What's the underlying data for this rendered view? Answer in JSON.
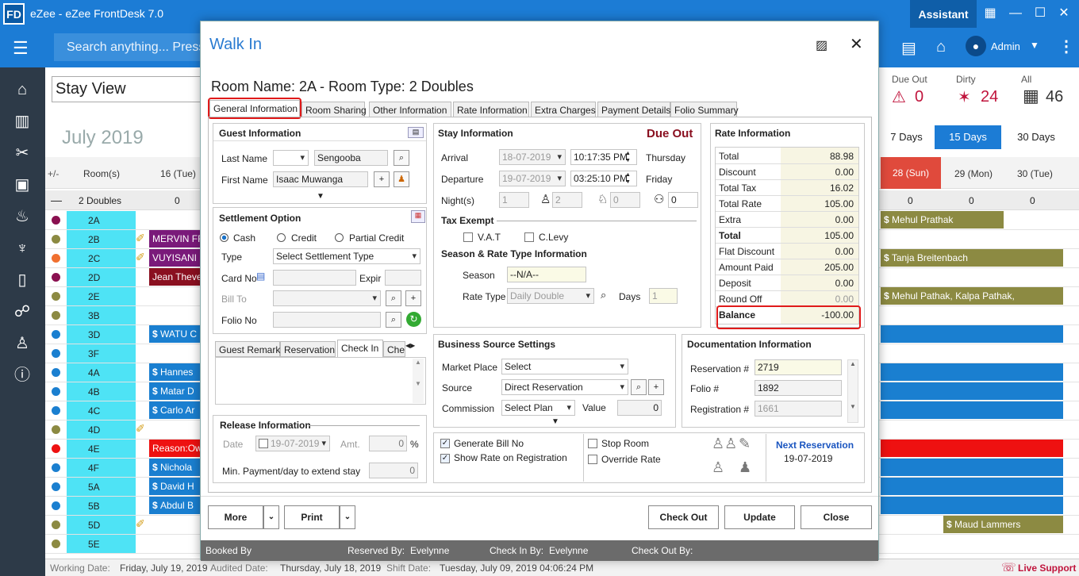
{
  "app": {
    "logo": "FD",
    "title": "eZee - eZee FrontDesk 7.0",
    "assistant": "Assistant",
    "user": "Admin"
  },
  "search": {
    "placeholder": "Search anything... Press"
  },
  "background": {
    "view_selector": "Stay View",
    "month": "July 2019",
    "stats": [
      {
        "label": "Due Out",
        "value": "0"
      },
      {
        "label": "Dirty",
        "value": "24"
      },
      {
        "label": "All",
        "value": "46"
      }
    ],
    "range_tabs": [
      "7 Days",
      "15 Days",
      "30 Days"
    ],
    "columns": {
      "plusminus": "+/-",
      "rooms": "Room(s)",
      "d16": "16 (Tue)",
      "d28": "28 (Sun)",
      "d29": "29 (Mon)",
      "d30": "30 (Tue)"
    },
    "group": {
      "name": "2 Doubles",
      "c16": "0",
      "c28": "0",
      "c29": "0",
      "c30": "0"
    },
    "rooms": [
      "2A",
      "2B",
      "2C",
      "2D",
      "2E",
      "3B",
      "3D",
      "3F",
      "4A",
      "4B",
      "4C",
      "4D",
      "4E",
      "4F",
      "5A",
      "5B",
      "5D",
      "5E"
    ],
    "left_guests": [
      "MERVIN FRA",
      "VUYISANI N",
      "Jean Thever",
      "WATU C",
      "Hannes",
      "Matar D",
      "Carlo Ar",
      "Reason:Own",
      "Nichola",
      "David H",
      "Abdul B"
    ],
    "right_guests": [
      "Mehul Prathak",
      "Tanja Breitenbach",
      "Mehul Pathak, Kalpa Pathak,",
      "Maud Lammers"
    ],
    "status": {
      "working_label": "Working Date:",
      "working": "Friday, July 19, 2019",
      "audited_label": "Audited Date:",
      "audited": "Thursday, July 18, 2019",
      "shift_label": "Shift Date:",
      "shift": "Tuesday, July 09, 2019 04:06:24 PM",
      "support": "Live Support"
    }
  },
  "dialog": {
    "title": "Walk In",
    "room_heading": "Room Name: 2A - Room Type: 2 Doubles",
    "tabs": [
      "General Information",
      "Room Sharing",
      "Other Information",
      "Rate Information",
      "Extra Charges",
      "Payment Details",
      "Folio Summary"
    ],
    "guest": {
      "heading": "Guest Information",
      "last_name_label": "Last Name",
      "last_name": "Sengooba",
      "first_name_label": "First Name",
      "first_name": "Isaac Muwanga"
    },
    "settlement": {
      "heading": "Settlement Option",
      "options": [
        "Cash",
        "Credit",
        "Partial Credit"
      ],
      "type_label": "Type",
      "type_value": "Select Settlement Type",
      "card_label": "Card No",
      "expiry_label": "Expir",
      "bill_to_label": "Bill To",
      "folio_label": "Folio No"
    },
    "remark_tabs": [
      "Guest Remark",
      "Reservation",
      "Check In",
      "Che"
    ],
    "release": {
      "heading": "Release Information",
      "date_label": "Date",
      "date": "19-07-2019",
      "amt_label": "Amt.",
      "amt": "0",
      "pct": "%",
      "min_pay_label": "Min. Payment/day to extend stay",
      "min_pay": "0"
    },
    "stay": {
      "heading": "Stay Information",
      "due_out": "Due Out",
      "arrival_label": "Arrival",
      "arrival_date": "18-07-2019",
      "arrival_time": "10:17:35 PM",
      "arrival_day": "Thursday",
      "departure_label": "Departure",
      "departure_date": "19-07-2019",
      "departure_time": "03:25:10 PM",
      "departure_day": "Friday",
      "nights_label": "Night(s)",
      "nights": "1",
      "adults": "2",
      "children": "0",
      "infants": "0",
      "tax_exempt": "Tax Exempt",
      "vat": "V.A.T",
      "clevy": "C.Levy",
      "season_rate_heading": "Season & Rate Type Information",
      "season_label": "Season",
      "season": "--N/A--",
      "rate_type_label": "Rate Type",
      "rate_type": "Daily Double",
      "days_label": "Days",
      "days": "1"
    },
    "rate": {
      "heading": "Rate Information",
      "rows": [
        {
          "label": "Total",
          "value": "88.98"
        },
        {
          "label": "Discount",
          "value": "0.00"
        },
        {
          "label": "Total Tax",
          "value": "16.02"
        },
        {
          "label": "Total Rate",
          "value": "105.00"
        },
        {
          "label": "Extra",
          "value": "0.00"
        },
        {
          "label": "Total",
          "value": "105.00"
        },
        {
          "label": "Flat Discount",
          "value": "0.00"
        },
        {
          "label": "Amount Paid",
          "value": "205.00"
        },
        {
          "label": "Deposit",
          "value": "0.00"
        },
        {
          "label": "Round Off",
          "value": "0.00"
        }
      ],
      "balance_label": "Balance",
      "balance": "-100.00"
    },
    "business": {
      "heading": "Business Source Settings",
      "market_label": "Market Place",
      "market": "Select",
      "source_label": "Source",
      "source": "Direct Reservation",
      "commission_label": "Commission",
      "commission": "Select Plan",
      "value_label": "Value",
      "value": "0"
    },
    "documentation": {
      "heading": "Documentation Information",
      "reservation_label": "Reservation #",
      "reservation": "2719",
      "folio_label": "Folio #",
      "folio": "1892",
      "registration_label": "Registration #",
      "registration": "1661"
    },
    "options": {
      "generate_bill": "Generate Bill No",
      "show_rate": "Show Rate on Registration",
      "stop_room": "Stop Room",
      "override_rate": "Override Rate"
    },
    "next_reservation": {
      "label": "Next Reservation",
      "date": "19-07-2019"
    },
    "buttons": {
      "more": "More",
      "print": "Print",
      "check_out": "Check Out",
      "update": "Update",
      "close": "Close"
    },
    "footer": {
      "booked_by": "Booked By",
      "reserved_by_label": "Reserved By:",
      "reserved_by": "Evelynne",
      "checkin_by_label": "Check In By:",
      "checkin_by": "Evelynne",
      "checkout_by_label": "Check Out By:"
    }
  }
}
